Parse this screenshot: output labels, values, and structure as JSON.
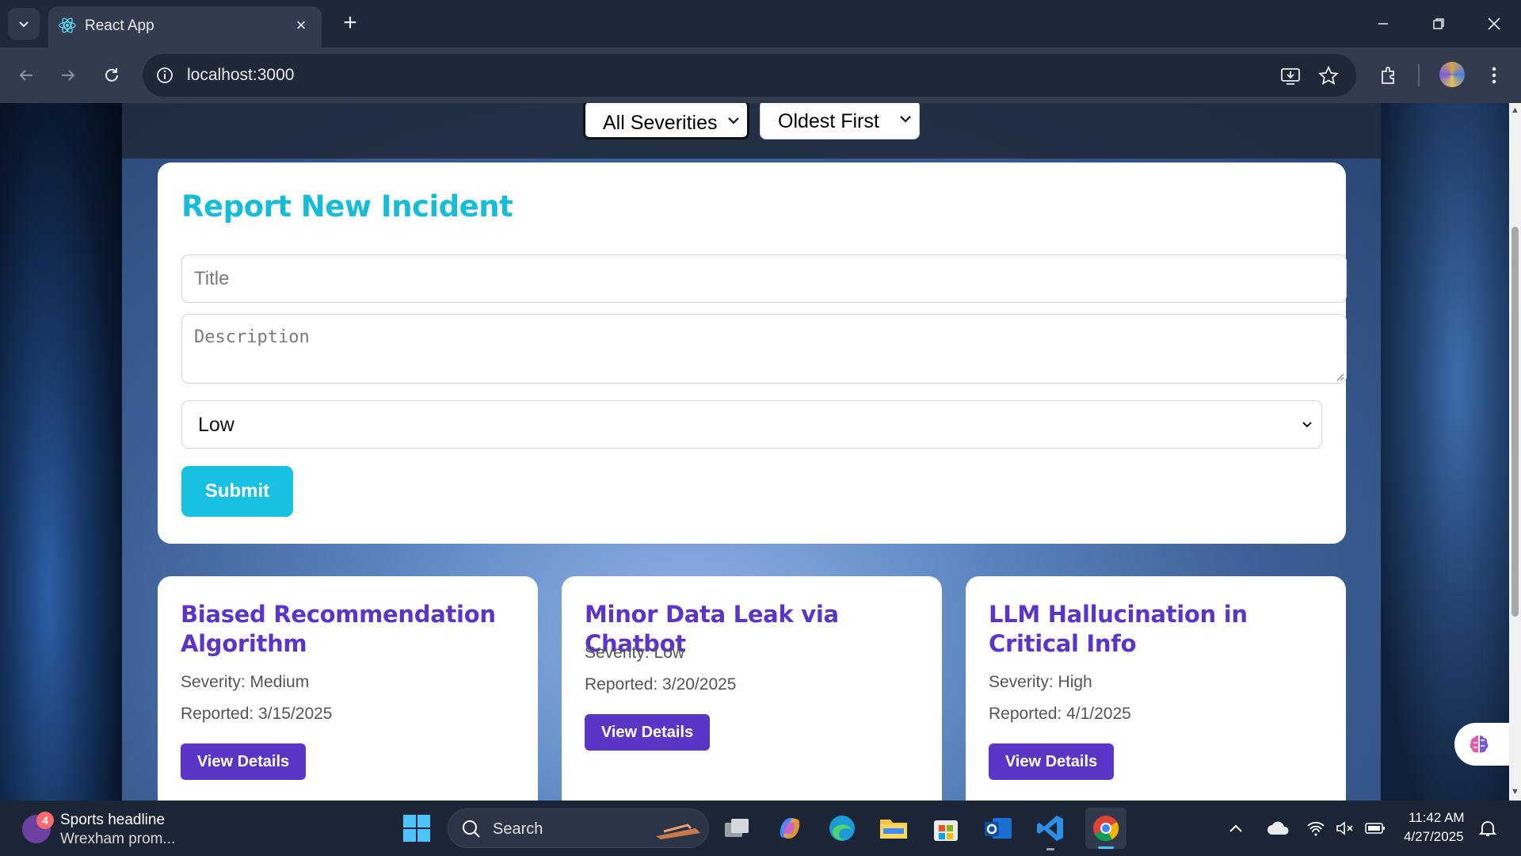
{
  "browser": {
    "tab_title": "React App",
    "url": "localhost:3000"
  },
  "filters": {
    "severity_selected": "All Severities",
    "sort_selected": "Oldest First"
  },
  "report_form": {
    "heading": "Report New Incident",
    "title_placeholder": "Title",
    "description_placeholder": "Description",
    "severity_value": "Low",
    "submit_label": "Submit"
  },
  "incidents": [
    {
      "title": "Biased Recommendation Algorithm",
      "severity": "Severity: Medium",
      "reported": "Reported: 3/15/2025",
      "button": "View Details"
    },
    {
      "title": "Minor Data Leak via Chatbot",
      "severity": "Severity: Low",
      "reported": "Reported: 3/20/2025",
      "button": "View Details"
    },
    {
      "title": "LLM Hallucination in Critical Info",
      "severity": "Severity: High",
      "reported": "Reported: 4/1/2025",
      "button": "View Details"
    }
  ],
  "taskbar": {
    "news_badge": "4",
    "news_headline": "Sports headline",
    "news_sub": "Wrexham prom...",
    "search_label": "Search",
    "time": "11:42 AM",
    "date": "4/27/2025"
  },
  "colors": {
    "accent_cyan": "#18c1e0",
    "accent_purple": "#5a35c6"
  }
}
